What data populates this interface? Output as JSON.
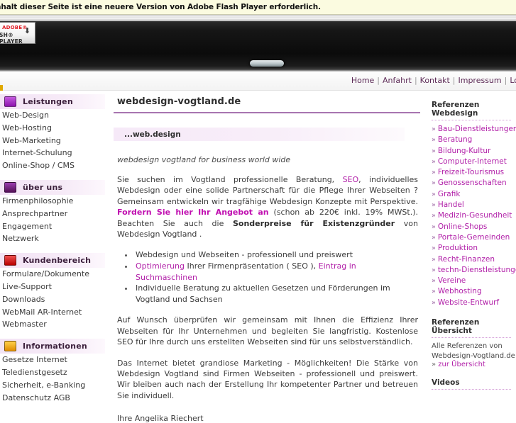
{
  "flash_bar": {
    "message": "nhalt dieser Seite ist eine neuere Version von Adobe Flash Player erforderlich.",
    "badge_brand": "ADOBE®",
    "badge_product": "SH® PLAYER",
    "badge_arrow": "⬇"
  },
  "topnav": {
    "items": [
      "Home",
      "Anfahrt",
      "Kontakt",
      "Impressum",
      "Log"
    ],
    "separator": "|"
  },
  "sidebar": {
    "sections": [
      {
        "title": "Leistungen",
        "icon_name": "purple-box-icon",
        "icon_color": "#a424c9",
        "items": [
          "Web-Design",
          "Web-Hosting",
          "Web-Marketing",
          "Internet-Schulung",
          "Online-Shop / CMS"
        ]
      },
      {
        "title": "über uns",
        "icon_name": "dark-purple-box-icon",
        "icon_color": "#6e2070",
        "items": [
          "Firmenphilosophie",
          "Ansprechpartner",
          "Engagement",
          "Netzwerk"
        ]
      },
      {
        "title": "Kundenbereich",
        "icon_name": "red-box-icon",
        "icon_color": "#d81a1a",
        "items": [
          "Formulare/Dokumente",
          "Live-Support",
          "Downloads",
          "WebMail AR-Internet",
          "Webmaster"
        ]
      },
      {
        "title": "Informationen",
        "icon_name": "orange-box-icon",
        "icon_color": "#f2a30a",
        "items": [
          "Gesetze Internet",
          "Teledienstgesetz",
          "Sicherheit, e-Banking",
          "Datenschutz AGB"
        ]
      }
    ]
  },
  "main": {
    "title": "webdesign-vogtland.de",
    "subheading": "...web.design",
    "tagline": "webdesign vogtland for business world wide",
    "paragraph1": {
      "part1": "Sie suchen im Vogtland professionelle Beratung, ",
      "link_seo": "SEO",
      "part2": ", individuelles Webdesign oder eine solide Partnerschaft für die Pflege Ihrer Webseiten ? Gemeinsam entwickeln wir tragfähige Webdesign Konzepte mit Perspektive. ",
      "link_offer": "Fordern Sie hier Ihr Angebot an",
      "part3": " (schon ab 220€ inkl. 19% MWSt.). Beachten Sie auch die ",
      "strong_special": "Sonderpreise für Existenzgründer",
      "part4": " von Webdesign Vogtland ."
    },
    "bullets": [
      {
        "text_before": "",
        "link1": "",
        "text_mid": "Webdesign und Webseiten - professionell und preiswert",
        "link2": "",
        "text_after": ""
      },
      {
        "text_before": "",
        "link1": "Optimierung",
        "text_mid": " Ihrer Firmenpräsentation ( SEO ), ",
        "link2": "Eintrag in Suchmaschinen",
        "text_after": ""
      },
      {
        "text_before": "Individuelle Beratung zu aktuellen Gesetzen und Förderungen im Vogtland und Sachsen",
        "link1": "",
        "text_mid": "",
        "link2": "",
        "text_after": ""
      }
    ],
    "paragraph2": "Auf Wunsch überprüfen wir gemeinsam mit Ihnen die Effizienz Ihrer Webseiten für Ihr Unternehmen und begleiten Sie langfristig. Kostenlose SEO für Ihre durch uns erstellten Webseiten sind für uns selbstverständlich.",
    "paragraph3": "Das Internet bietet grandiose Marketing - Möglichkeiten! Die Stärke von Webdesign Vogtland sind Firmen Webseiten - professionell und preiswert. Wir bleiben auch nach der Erstellung Ihr kompetenter Partner und betreuen Sie individuell.",
    "signature": "Ihre Angelika Riechert"
  },
  "rightbar": {
    "references_heading": "Referenzen Webdesign",
    "chevron": "»",
    "references": [
      "Bau-Dienstleistungen",
      "Beratung",
      "Bildung-Kultur",
      "Computer-Internet",
      "Freizeit-Tourismus",
      "Genossenschaften",
      "Grafik",
      "Handel",
      "Medizin-Gesundheit",
      "Online-Shops",
      "Portale-Gemeinden",
      "Produktion",
      "Recht-Finanzen",
      "techn-Dienstleistungen",
      "Vereine",
      "Webhosting",
      "Website-Entwurf"
    ],
    "overview_heading": "Referenzen Übersicht",
    "overview_text_line1": "Alle Referenzen von",
    "overview_text_line2": "Webdesign-Vogtland.de",
    "overview_prefix": "» ",
    "overview_link": "zur Übersicht",
    "videos_heading": "Videos"
  },
  "colors": {
    "accent_purple": "#b11fa8",
    "title_rule": "#a875b0",
    "nav_link": "#5c2a56",
    "band_bg": "#f6e9f8"
  }
}
